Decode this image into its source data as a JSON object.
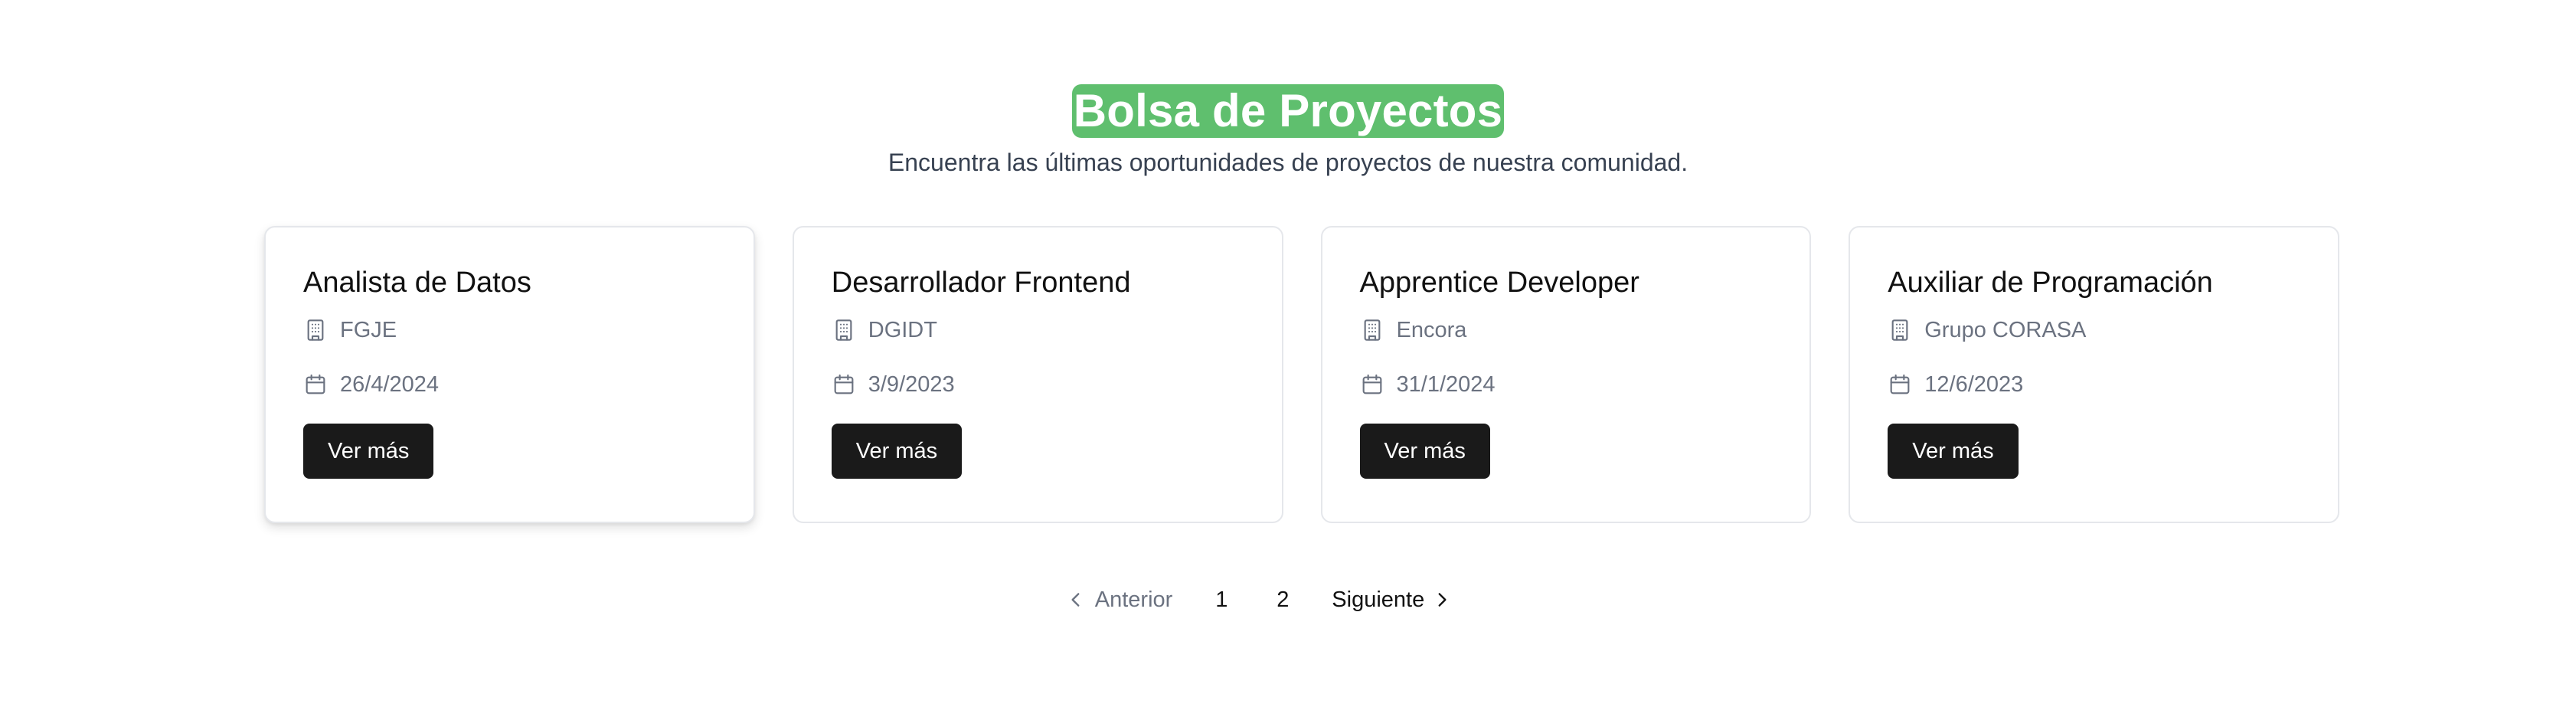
{
  "header": {
    "title": "Bolsa de Proyectos",
    "subtitle": "Encuentra las últimas oportunidades de proyectos de nuestra comunidad."
  },
  "colors": {
    "title_highlight": "#5fbf6e",
    "button_bg": "#1a1a1a",
    "muted_text": "#6b7280"
  },
  "cards": [
    {
      "title": "Analista de Datos",
      "company": "FGJE",
      "date": "26/4/2024",
      "button_label": "Ver más",
      "company_icon": "building-icon",
      "date_icon": "calendar-icon"
    },
    {
      "title": "Desarrollador Frontend",
      "company": "DGIDT",
      "date": "3/9/2023",
      "button_label": "Ver más",
      "company_icon": "building-icon",
      "date_icon": "calendar-icon"
    },
    {
      "title": "Apprentice Developer",
      "company": "Encora",
      "date": "31/1/2024",
      "button_label": "Ver más",
      "company_icon": "building-icon",
      "date_icon": "calendar-icon"
    },
    {
      "title": "Auxiliar de Programación",
      "company": "Grupo CORASA",
      "date": "12/6/2023",
      "button_label": "Ver más",
      "company_icon": "building-icon",
      "date_icon": "calendar-icon"
    }
  ],
  "pagination": {
    "previous_label": "Anterior",
    "next_label": "Siguiente",
    "pages": [
      "1",
      "2"
    ]
  }
}
